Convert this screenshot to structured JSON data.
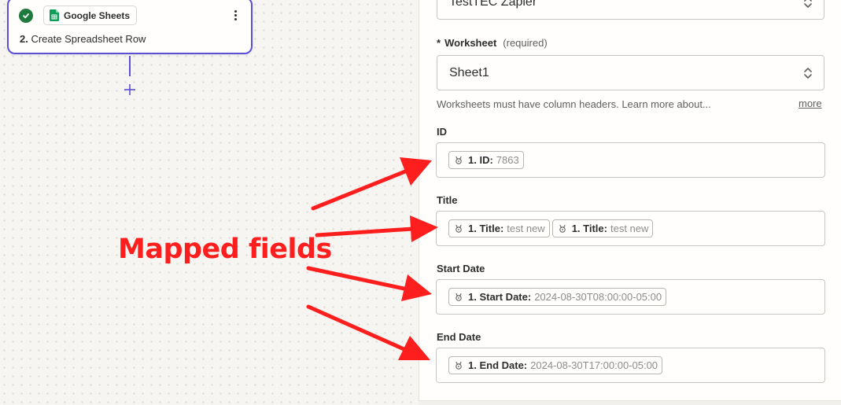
{
  "canvas": {
    "step": {
      "app_name": "Google Sheets",
      "number": "2.",
      "title": "Create Spreadsheet Row"
    },
    "add_step_label": "+"
  },
  "panel": {
    "account_value": "TestTEC Zapier",
    "worksheet": {
      "required_marker": "*",
      "label": "Worksheet",
      "required_text": "(required)",
      "value": "Sheet1",
      "help_text": "Worksheets must have column headers. Learn more about...",
      "more_link": "more"
    },
    "fields": [
      {
        "label": "ID",
        "pills": [
          {
            "key": "1. ID:",
            "value": "7863"
          }
        ]
      },
      {
        "label": "Title",
        "pills": [
          {
            "key": "1. Title:",
            "value": "test new"
          },
          {
            "key": "1. Title:",
            "value": "test new"
          }
        ]
      },
      {
        "label": "Start Date",
        "pills": [
          {
            "key": "1. Start Date:",
            "value": "2024-08-30T08:00:00-05:00"
          }
        ]
      },
      {
        "label": "End Date",
        "pills": [
          {
            "key": "1. End Date:",
            "value": "2024-08-30T17:00:00-05:00"
          }
        ]
      }
    ]
  },
  "annotation": {
    "text": "Mapped fields",
    "color": "#ff1e1e"
  },
  "colors": {
    "accent": "#5b4fd6",
    "success": "#1f7a3e",
    "sheets_green": "#0f9d58"
  },
  "icons": {
    "step_status": "check-circle-icon",
    "app": "google-sheets-icon",
    "menu": "kebab-menu-icon",
    "select": "up-down-chevron-icon",
    "pill": "webhook-icon"
  }
}
